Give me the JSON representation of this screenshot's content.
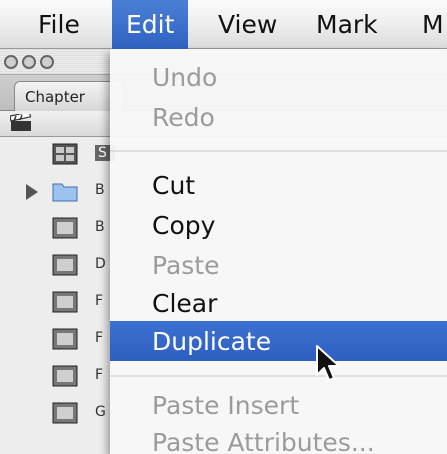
{
  "menubar": {
    "items": [
      "File",
      "Edit",
      "View",
      "Mark",
      "M"
    ],
    "active": "Edit"
  },
  "window": {
    "tab_label": "Chapter",
    "rows": [
      {
        "text": "S",
        "kind": "sequence"
      },
      {
        "text": "B",
        "kind": "folder"
      },
      {
        "text": "B",
        "kind": "clip"
      },
      {
        "text": "D",
        "kind": "clip"
      },
      {
        "text": "F",
        "kind": "clip"
      },
      {
        "text": "F",
        "kind": "clip"
      },
      {
        "text": "F",
        "kind": "clip"
      },
      {
        "text": "G",
        "kind": "clip"
      }
    ]
  },
  "edit_menu": {
    "undo": "Undo",
    "redo": "Redo",
    "cut": "Cut",
    "copy": "Copy",
    "paste": "Paste",
    "clear": "Clear",
    "duplicate": "Duplicate",
    "paste_insert": "Paste Insert",
    "paste_attributes": "Paste Attributes..."
  },
  "colors": {
    "highlight": "#2f62c2",
    "disabled_text": "#9b9b9b"
  },
  "icons": {
    "cursor": "arrow-pointer-icon",
    "clapper": "clapperboard-icon",
    "folder": "folder-icon",
    "clip": "film-clip-icon"
  }
}
